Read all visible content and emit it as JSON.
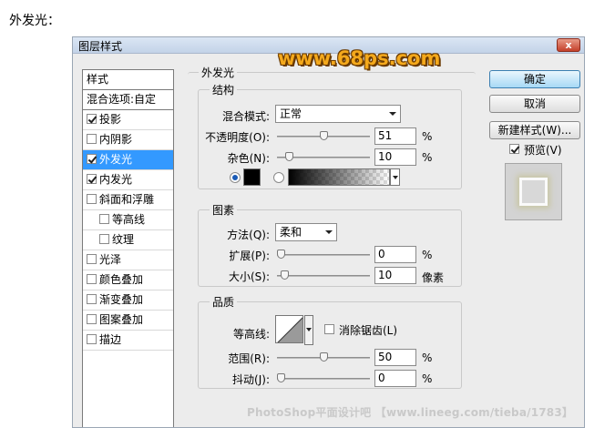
{
  "caption": "外发光：",
  "window": {
    "title": "图层样式",
    "close": "x"
  },
  "logo": "www.68ps.com",
  "style_list": {
    "items": [
      {
        "label": "样式",
        "checkbox": false,
        "checked": false,
        "selected": false,
        "indent": false,
        "head": true
      },
      {
        "label": "混合选项:自定",
        "checkbox": false,
        "checked": false,
        "selected": false,
        "indent": false,
        "head": true
      },
      {
        "label": "投影",
        "checkbox": true,
        "checked": true,
        "selected": false,
        "indent": false
      },
      {
        "label": "内阴影",
        "checkbox": true,
        "checked": false,
        "selected": false,
        "indent": false
      },
      {
        "label": "外发光",
        "checkbox": true,
        "checked": true,
        "selected": true,
        "indent": false
      },
      {
        "label": "内发光",
        "checkbox": true,
        "checked": true,
        "selected": false,
        "indent": false
      },
      {
        "label": "斜面和浮雕",
        "checkbox": true,
        "checked": false,
        "selected": false,
        "indent": false
      },
      {
        "label": "等高线",
        "checkbox": true,
        "checked": false,
        "selected": false,
        "indent": true
      },
      {
        "label": "纹理",
        "checkbox": true,
        "checked": false,
        "selected": false,
        "indent": true
      },
      {
        "label": "光泽",
        "checkbox": true,
        "checked": false,
        "selected": false,
        "indent": false
      },
      {
        "label": "颜色叠加",
        "checkbox": true,
        "checked": false,
        "selected": false,
        "indent": false
      },
      {
        "label": "渐变叠加",
        "checkbox": true,
        "checked": false,
        "selected": false,
        "indent": false
      },
      {
        "label": "图案叠加",
        "checkbox": true,
        "checked": false,
        "selected": false,
        "indent": false
      },
      {
        "label": "描边",
        "checkbox": true,
        "checked": false,
        "selected": false,
        "indent": false
      }
    ]
  },
  "panel": {
    "title": "外发光",
    "structure": {
      "title": "结构",
      "blend_mode_label": "混合模式:",
      "blend_mode_value": "正常",
      "opacity_label": "不透明度(O):",
      "opacity_value": "51",
      "opacity_unit": "%",
      "opacity_level": 0.51,
      "noise_label": "杂色(N):",
      "noise_value": "10",
      "noise_unit": "%",
      "noise_level": 0.1,
      "color_swatch": "#000000",
      "color_radio_selected": true,
      "gradient_radio_selected": false
    },
    "elements": {
      "title": "图素",
      "method_label": "方法(Q):",
      "method_value": "柔和",
      "spread_label": "扩展(P):",
      "spread_value": "0",
      "spread_unit": "%",
      "spread_level": 0.0,
      "size_label": "大小(S):",
      "size_value": "10",
      "size_unit": "像素",
      "size_level": 0.04
    },
    "quality": {
      "title": "品质",
      "contour_label": "等高线:",
      "anti_alias_label": "消除锯齿(L)",
      "anti_alias_checked": false,
      "range_label": "范围(R):",
      "range_value": "50",
      "range_unit": "%",
      "range_level": 0.5,
      "jitter_label": "抖动(J):",
      "jitter_value": "0",
      "jitter_unit": "%",
      "jitter_level": 0.0
    }
  },
  "buttons": {
    "ok": "确定",
    "cancel": "取消",
    "new_style": "新建样式(W)...",
    "preview_label": "预览(V)",
    "preview_checked": true
  },
  "watermark": "PhotoShop平面设计吧 【www.lineeg.com/tieba/1783】",
  "colors": {
    "selection": "#3399ff",
    "logo": "#f4a91c",
    "dialog_bg": "#ececec"
  }
}
